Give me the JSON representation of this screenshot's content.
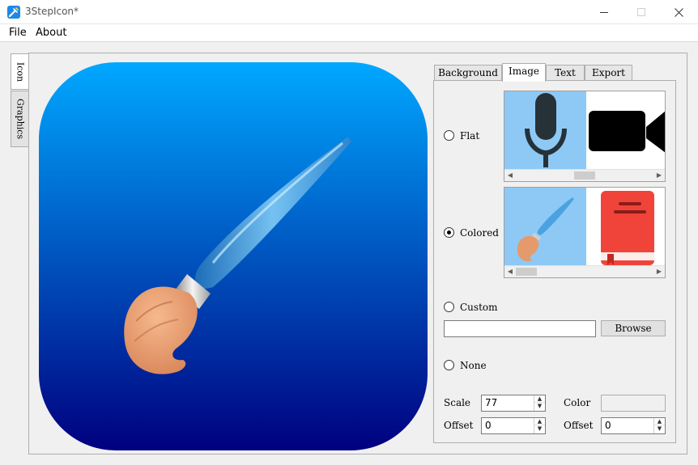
{
  "window": {
    "title": "3StepIcon*",
    "minimize_glyph": "minimize-icon",
    "maximize_glyph": "maximize-icon",
    "close_glyph": "close-icon"
  },
  "menu": {
    "items": [
      "File",
      "About"
    ]
  },
  "left_tabs": [
    {
      "label": "Icon",
      "active": true
    },
    {
      "label": "Graphics",
      "active": false
    }
  ],
  "preview": {
    "gradient_top": "#00a8ff",
    "gradient_bottom": "#00007f",
    "graphic": "paintbrush-icon"
  },
  "right_tabs": [
    {
      "label": "Background",
      "active": false
    },
    {
      "label": "Image",
      "active": true
    },
    {
      "label": "Text",
      "active": false
    },
    {
      "label": "Export",
      "active": false
    }
  ],
  "image_panel": {
    "flat": {
      "label": "Flat",
      "checked": false,
      "thumbnails": [
        "microphone-icon",
        "video-camera-icon"
      ]
    },
    "colored": {
      "label": "Colored",
      "checked": true,
      "thumbnails": [
        "paintbrush-icon",
        "red-book-icon"
      ]
    },
    "custom": {
      "label": "Custom",
      "checked": false,
      "path_value": "",
      "browse_label": "Browse"
    },
    "none": {
      "label": "None",
      "checked": false
    },
    "scale": {
      "label": "Scale",
      "value": "77"
    },
    "color": {
      "label": "Color",
      "value": ""
    },
    "offset_x": {
      "label": "Offset",
      "value": "0"
    },
    "offset_y": {
      "label": "Offset",
      "value": "0"
    }
  },
  "colors": {
    "selection": "#8ec9f6",
    "book_red": "#f0443a"
  }
}
